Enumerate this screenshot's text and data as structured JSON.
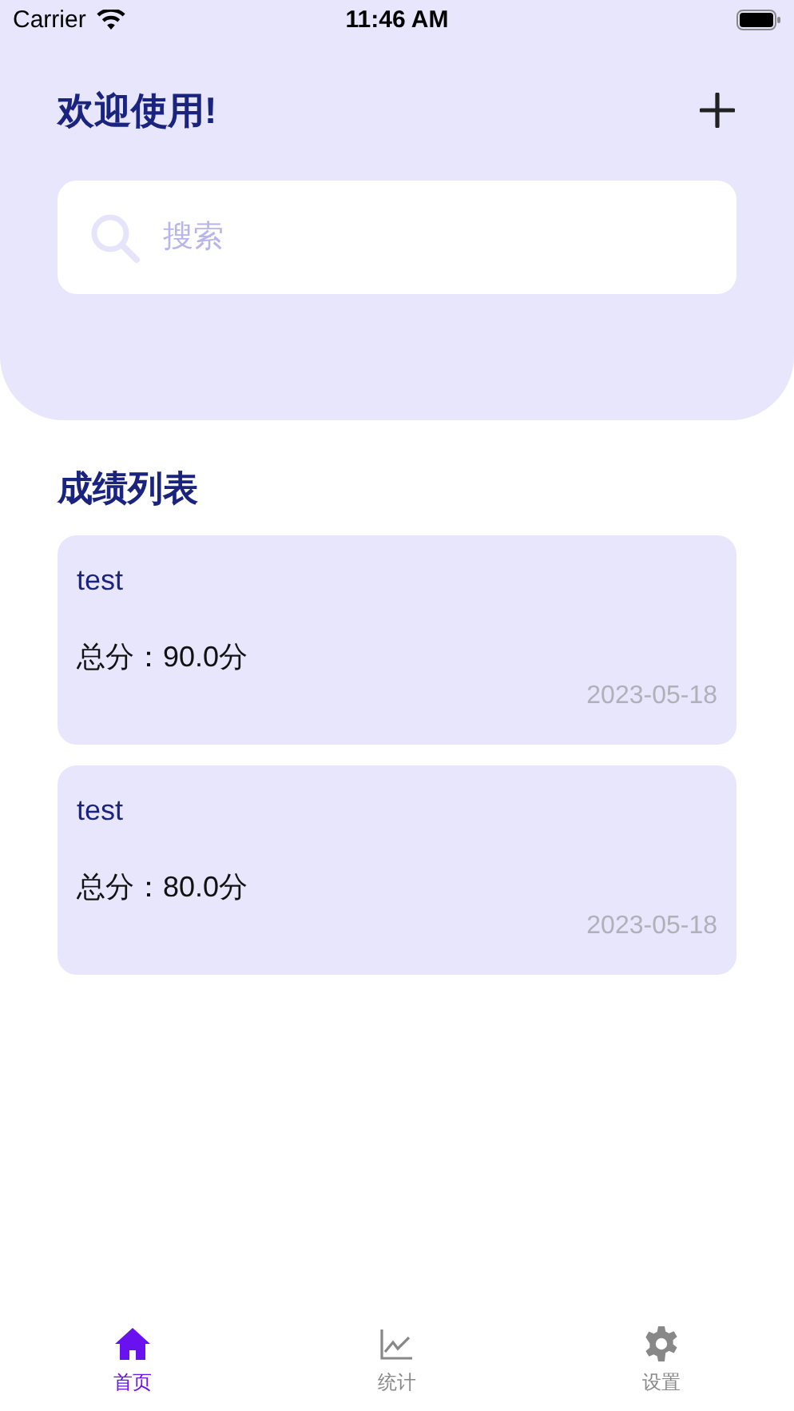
{
  "status_bar": {
    "carrier": "Carrier",
    "time": "11:46 AM"
  },
  "header": {
    "title": "欢迎使用!",
    "search": {
      "placeholder": "搜索"
    }
  },
  "section_title": "成绩列表",
  "records": [
    {
      "name": "test",
      "score": "总分：90.0分",
      "date": "2023-05-18"
    },
    {
      "name": "test",
      "score": "总分：80.0分",
      "date": "2023-05-18"
    }
  ],
  "tab_bar": [
    {
      "label": "首页",
      "selected": true
    },
    {
      "label": "统计",
      "selected": false
    },
    {
      "label": "设置",
      "selected": false
    }
  ]
}
